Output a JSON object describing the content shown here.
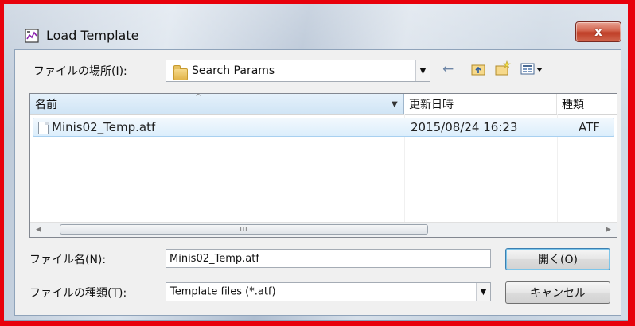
{
  "window": {
    "title": "Load Template",
    "close_glyph": "x"
  },
  "look_in": {
    "label": "ファイルの場所(I):",
    "value": "Search Params",
    "icon": "folder-icon"
  },
  "toolbar": {
    "back_icon": "←",
    "up_icon": "⧉",
    "new_folder_icon": "✦",
    "view_menu_icon": "▦▾"
  },
  "file_list": {
    "columns": [
      "名前",
      "更新日時",
      "種類"
    ],
    "rows": [
      {
        "name": "Minis02_Temp.atf",
        "modified": "2015/08/24 16:23",
        "type": "ATF"
      }
    ],
    "scroll_thumb_glyph": "III"
  },
  "filename": {
    "label": "ファイル名(N):",
    "value": "Minis02_Temp.atf"
  },
  "filetype": {
    "label": "ファイルの種類(T):",
    "value": "Template files (*.atf)"
  },
  "buttons": {
    "open": "開く(O)",
    "cancel": "キャンセル"
  },
  "colors": {
    "highlight_frame": "#e8000b",
    "close_button": "#c94a33",
    "selected_row": "#dceefc"
  }
}
